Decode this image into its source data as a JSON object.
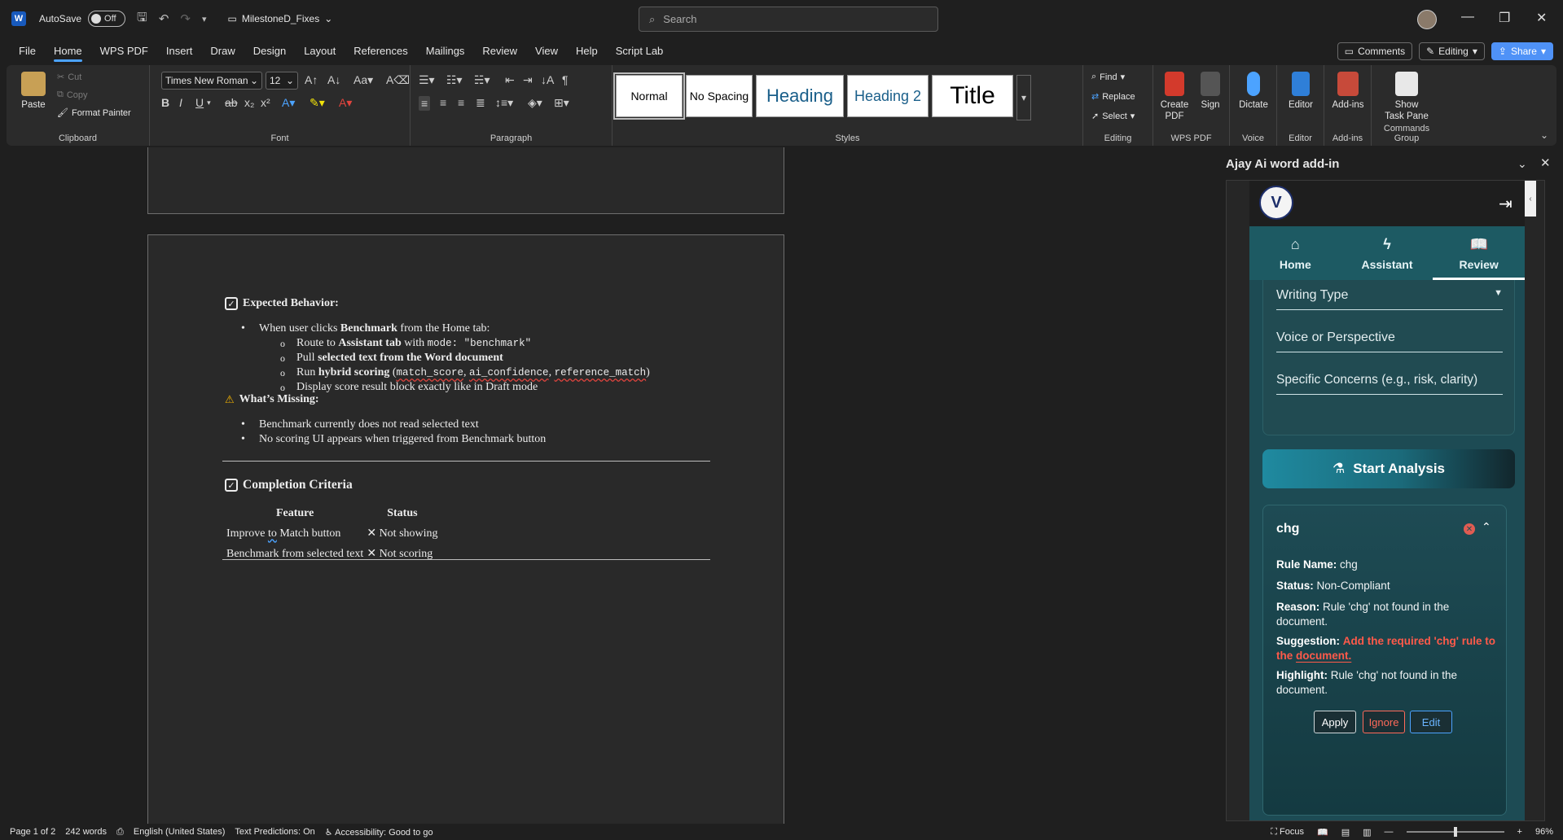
{
  "titlebar": {
    "app_icon": "W",
    "autosave_label": "AutoSave",
    "autosave_state": "Off",
    "doc_name": "MilestoneD_Fixes",
    "search_placeholder": "Search"
  },
  "menu": {
    "tabs": [
      "File",
      "Home",
      "WPS PDF",
      "Insert",
      "Draw",
      "Design",
      "Layout",
      "References",
      "Mailings",
      "Review",
      "View",
      "Help",
      "Script Lab"
    ],
    "active": "Home",
    "comments_label": "Comments",
    "editing_label": "Editing",
    "share_label": "Share"
  },
  "ribbon": {
    "clipboard": {
      "paste": "Paste",
      "cut": "Cut",
      "copy": "Copy",
      "format_painter": "Format Painter",
      "label": "Clipboard"
    },
    "font": {
      "family": "Times New Roman",
      "size": "12",
      "label": "Font"
    },
    "paragraph": {
      "label": "Paragraph"
    },
    "styles": {
      "items": [
        "Normal",
        "No Spacing",
        "Heading",
        "Heading 2",
        "Title"
      ],
      "label": "Styles"
    },
    "editing": {
      "find": "Find",
      "replace": "Replace",
      "select": "Select",
      "label": "Editing"
    },
    "wps": {
      "create_pdf_1": "Create",
      "create_pdf_2": "PDF",
      "sign": "Sign",
      "label": "WPS PDF"
    },
    "voice": {
      "dictate": "Dictate",
      "label": "Voice"
    },
    "editor": {
      "editor": "Editor",
      "label": "Editor"
    },
    "addins": {
      "addins": "Add-ins",
      "label": "Add-ins"
    },
    "commands": {
      "show_1": "Show",
      "show_2": "Task Pane",
      "label": "Commands Group"
    }
  },
  "document": {
    "expected_heading": "Expected Behavior:",
    "b1_pre": "When user clicks ",
    "b1_bold": "Benchmark",
    "b1_post": " from the Home tab:",
    "s1_pre": "Route to ",
    "s1_bold": "Assistant tab",
    "s1_mid": " with ",
    "s1_code": "mode: \"benchmark\"",
    "s2_pre": "Pull ",
    "s2_bold": "selected text from the Word document",
    "s3_pre": "Run ",
    "s3_bold": "hybrid scoring",
    "s3_open": " (",
    "s3_c1": "match_score",
    "s3_sep1": ", ",
    "s3_c2": "ai_confidence",
    "s3_sep2": ", ",
    "s3_c3": "reference_match",
    "s3_close": ")",
    "s4": "Display score result block exactly like in Draft mode",
    "missing_heading": "What’s Missing:",
    "m1": "Benchmark currently does not read selected text",
    "m2": "No scoring UI appears when triggered from Benchmark button",
    "completion_heading": "Completion Criteria",
    "table": {
      "headers": [
        "Feature",
        "Status"
      ],
      "rows": [
        {
          "feature_pre": "Improve ",
          "feature_sq": "to",
          "feature_post": " Match button",
          "status": "Not showing"
        },
        {
          "feature_pre": "Benchmark from selected text",
          "feature_sq": "",
          "feature_post": "",
          "status": "Not scoring"
        }
      ]
    }
  },
  "taskpane": {
    "title": "Ajay Ai word add-in",
    "tabs": [
      "Home",
      "Assistant",
      "Review"
    ],
    "active_tab": "Review",
    "fields": [
      "Writing Type",
      "Voice or Perspective",
      "Specific Concerns (e.g., risk, clarity)"
    ],
    "start_button": "Start Analysis",
    "result": {
      "title": "chg",
      "rule_label": "Rule Name:",
      "rule_value": "chg",
      "status_label": "Status:",
      "status_value": "Non-Compliant",
      "reason_label": "Reason:",
      "reason_value": "Rule 'chg' not found in the document.",
      "suggestion_label": "Suggestion:",
      "suggestion_value_1": "Add the required 'chg' rule to the ",
      "suggestion_value_2": "document.",
      "highlight_label": "Highlight:",
      "highlight_value": "Rule 'chg' not found in the document.",
      "apply": "Apply",
      "ignore": "Ignore",
      "edit": "Edit"
    }
  },
  "statusbar": {
    "page": "Page 1 of 2",
    "words": "242 words",
    "language": "English (United States)",
    "predictions": "Text Predictions: On",
    "accessibility": "Accessibility: Good to go",
    "focus": "Focus",
    "zoom": "96%"
  },
  "colors": {
    "accent": "#4ca3ff",
    "share": "#4f92f7",
    "addin_teal": "#1d4b54",
    "suggestion_red": "#ff5a4a"
  }
}
